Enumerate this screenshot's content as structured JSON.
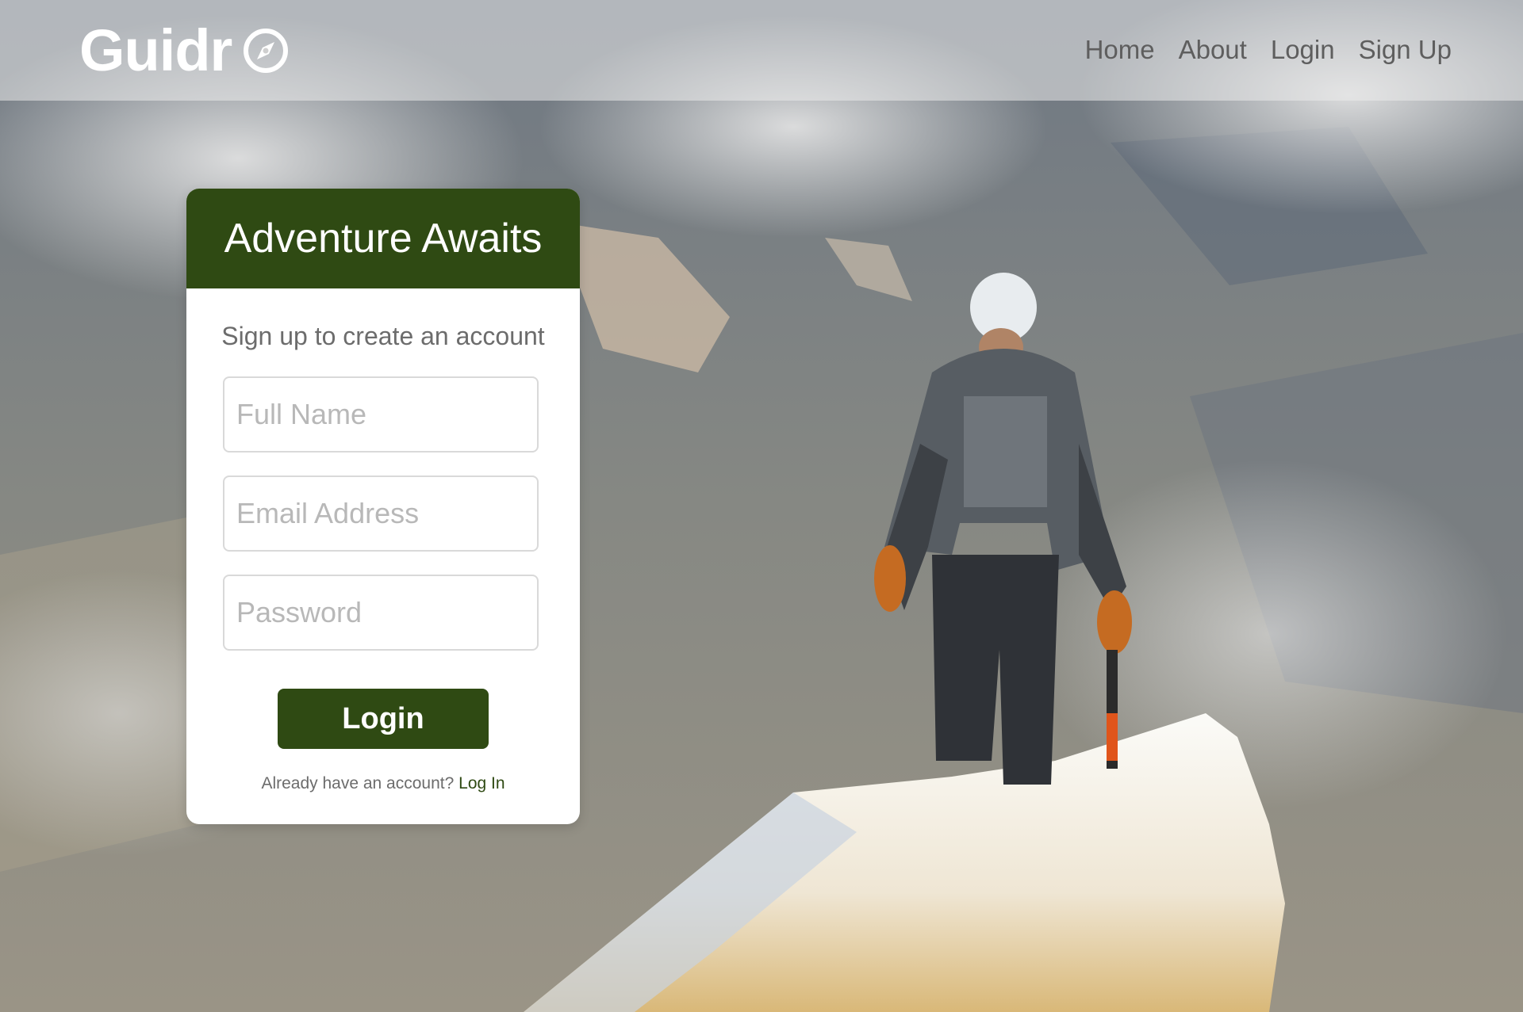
{
  "brand": {
    "name": "Guidr",
    "icon": "compass-icon",
    "color": "#ffffff"
  },
  "nav": {
    "items": [
      {
        "label": "Home"
      },
      {
        "label": "About"
      },
      {
        "label": "Login"
      },
      {
        "label": "Sign Up"
      }
    ]
  },
  "hero": {
    "image": "mountaineer-on-snowy-summit"
  },
  "form": {
    "title": "Adventure Awaits",
    "subtitle": "Sign up to create an account",
    "fields": {
      "full_name": {
        "placeholder": "Full Name",
        "value": ""
      },
      "email": {
        "placeholder": "Email Address",
        "value": ""
      },
      "password": {
        "placeholder": "Password",
        "value": ""
      }
    },
    "submit_label": "Login",
    "footer_text": "Already have an account?",
    "footer_link": "Log In"
  },
  "colors": {
    "accent": "#2f4a13",
    "nav_text": "#5e5e5e",
    "muted_text": "#6c6c6c",
    "placeholder": "#b8b8b8"
  }
}
